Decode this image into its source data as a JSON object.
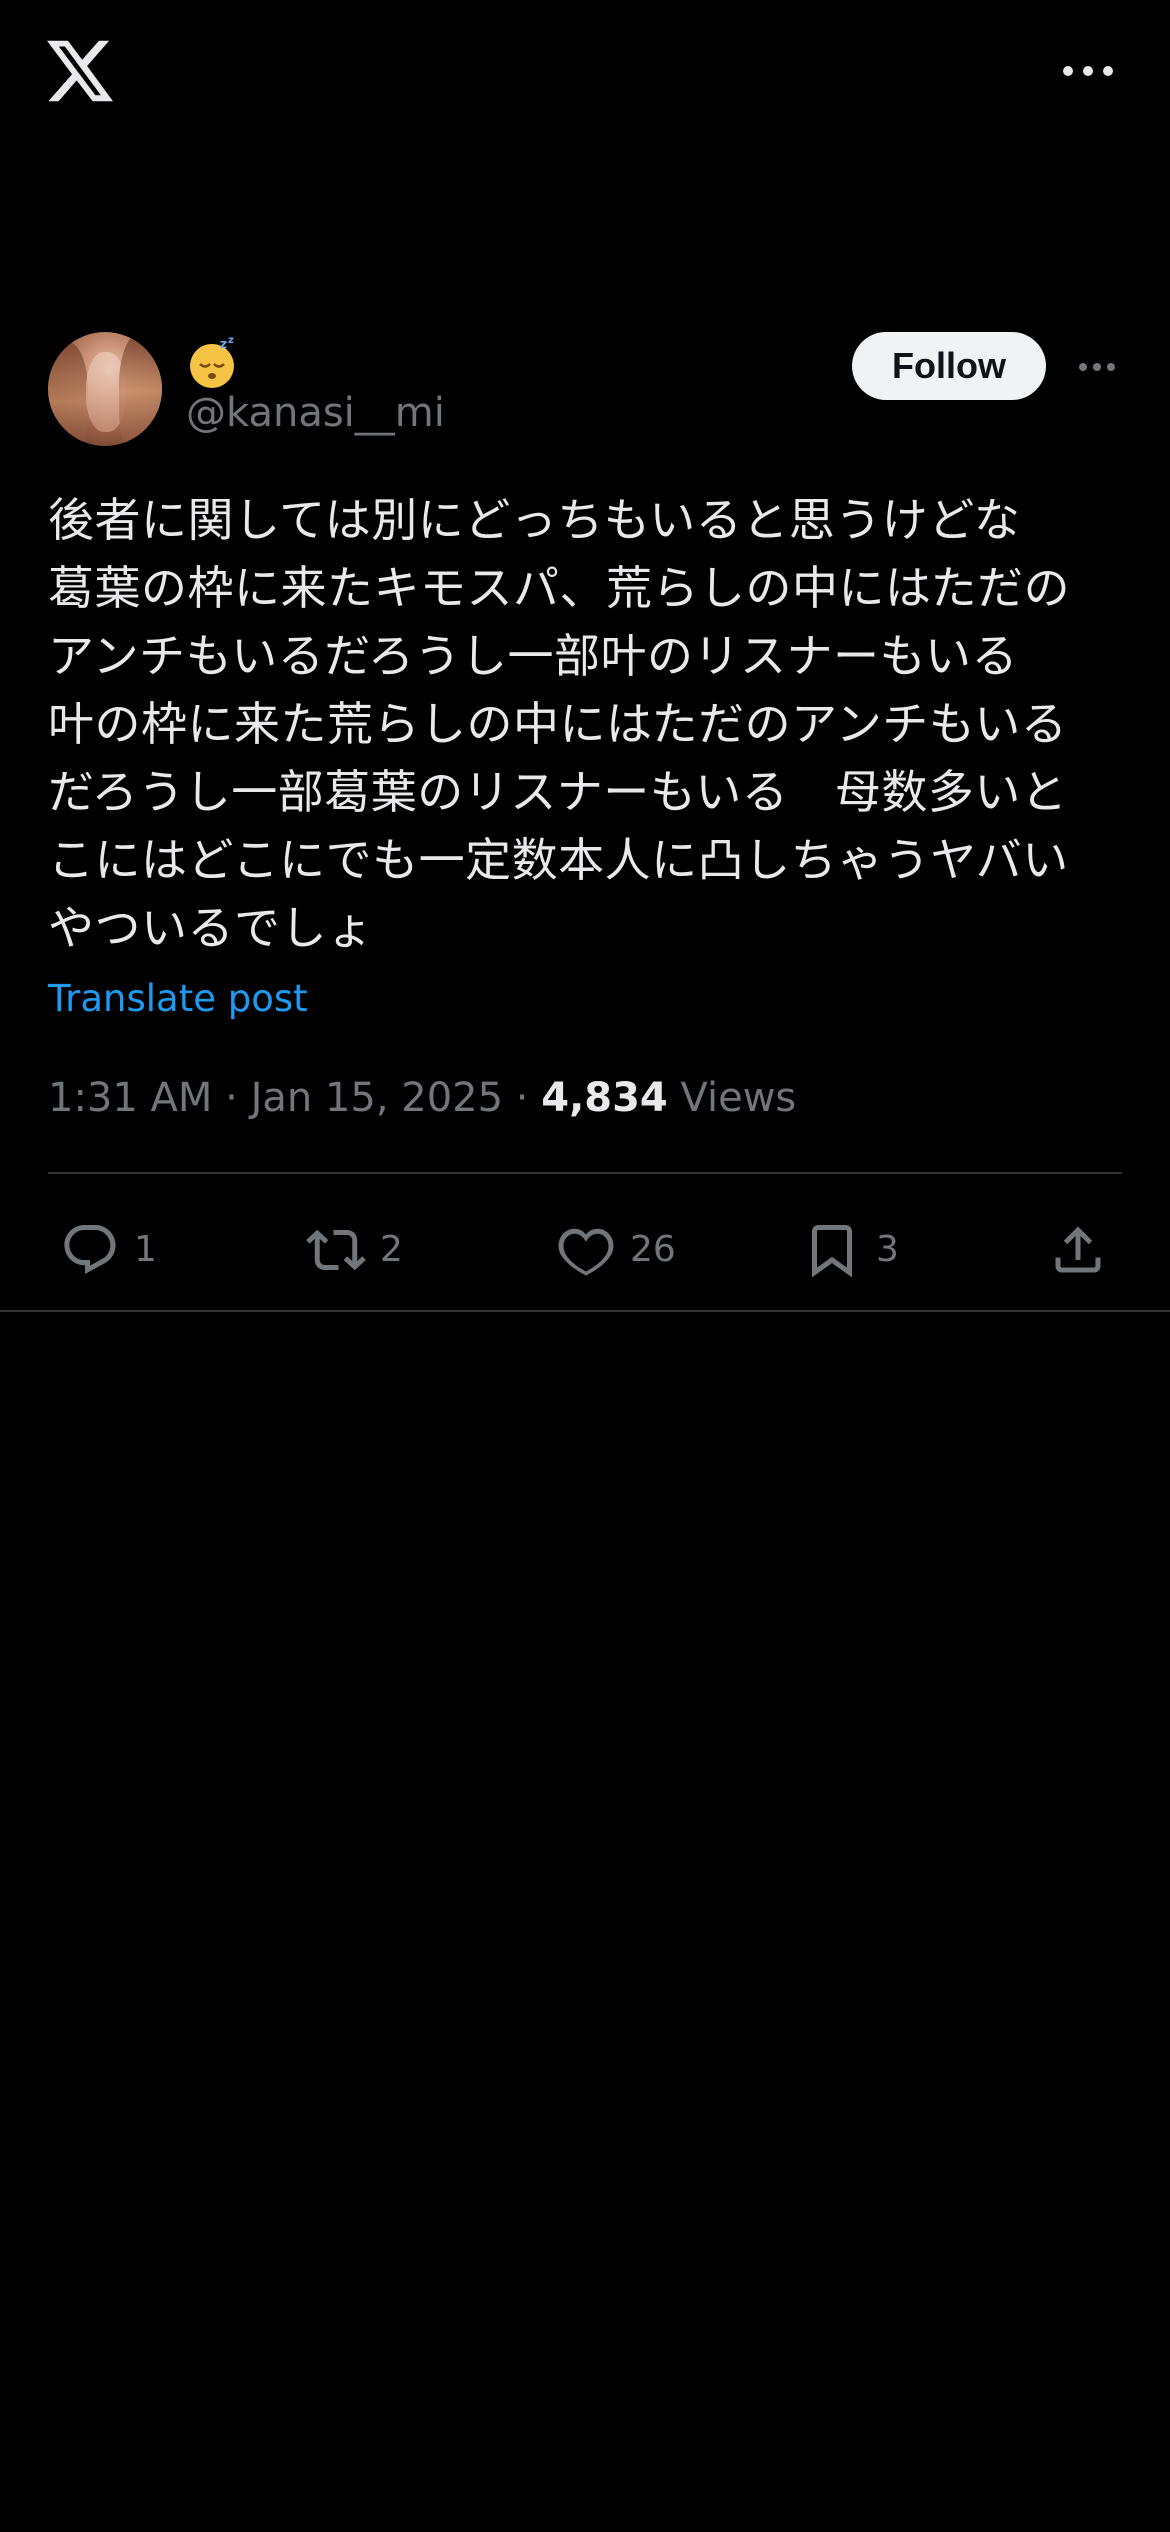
{
  "app": {
    "logo": "x-logo-icon",
    "more_icon": "more-horizontal-icon"
  },
  "post": {
    "author": {
      "display_name_emoji": "😴",
      "handle": "@kanasi__mi",
      "avatar": "avatar"
    },
    "follow_label": "Follow",
    "text": "後者に関しては別にどっちもいると思うけどな\n葛葉の枠に来たキモスパ、荒らしの中にはただの\nアンチもいるだろうし一部叶のリスナーもいる\n叶の枠に来た荒らしの中にはただのアンチもいる\nだろうし一部葛葉のリスナーもいる　母数多いと\nこにはどこにでも一定数本人に凸しちゃうヤバい\nやついるでしょ",
    "translate_label": "Translate post",
    "time": "1:31 AM",
    "date": "Jan 15, 2025",
    "separator": "·",
    "views_count": "4,834",
    "views_label": "Views"
  },
  "actions": {
    "reply": {
      "icon": "reply-icon",
      "count": "1"
    },
    "repost": {
      "icon": "repost-icon",
      "count": "2"
    },
    "like": {
      "icon": "heart-icon",
      "count": "26"
    },
    "bookmark": {
      "icon": "bookmark-icon",
      "count": "3"
    },
    "share": {
      "icon": "share-icon"
    }
  },
  "colors": {
    "background": "#000000",
    "text": "#e7e9ea",
    "secondary": "#71767b",
    "link": "#1d9bf0",
    "divider": "#2f3336",
    "follow_bg": "#eff3f4"
  }
}
